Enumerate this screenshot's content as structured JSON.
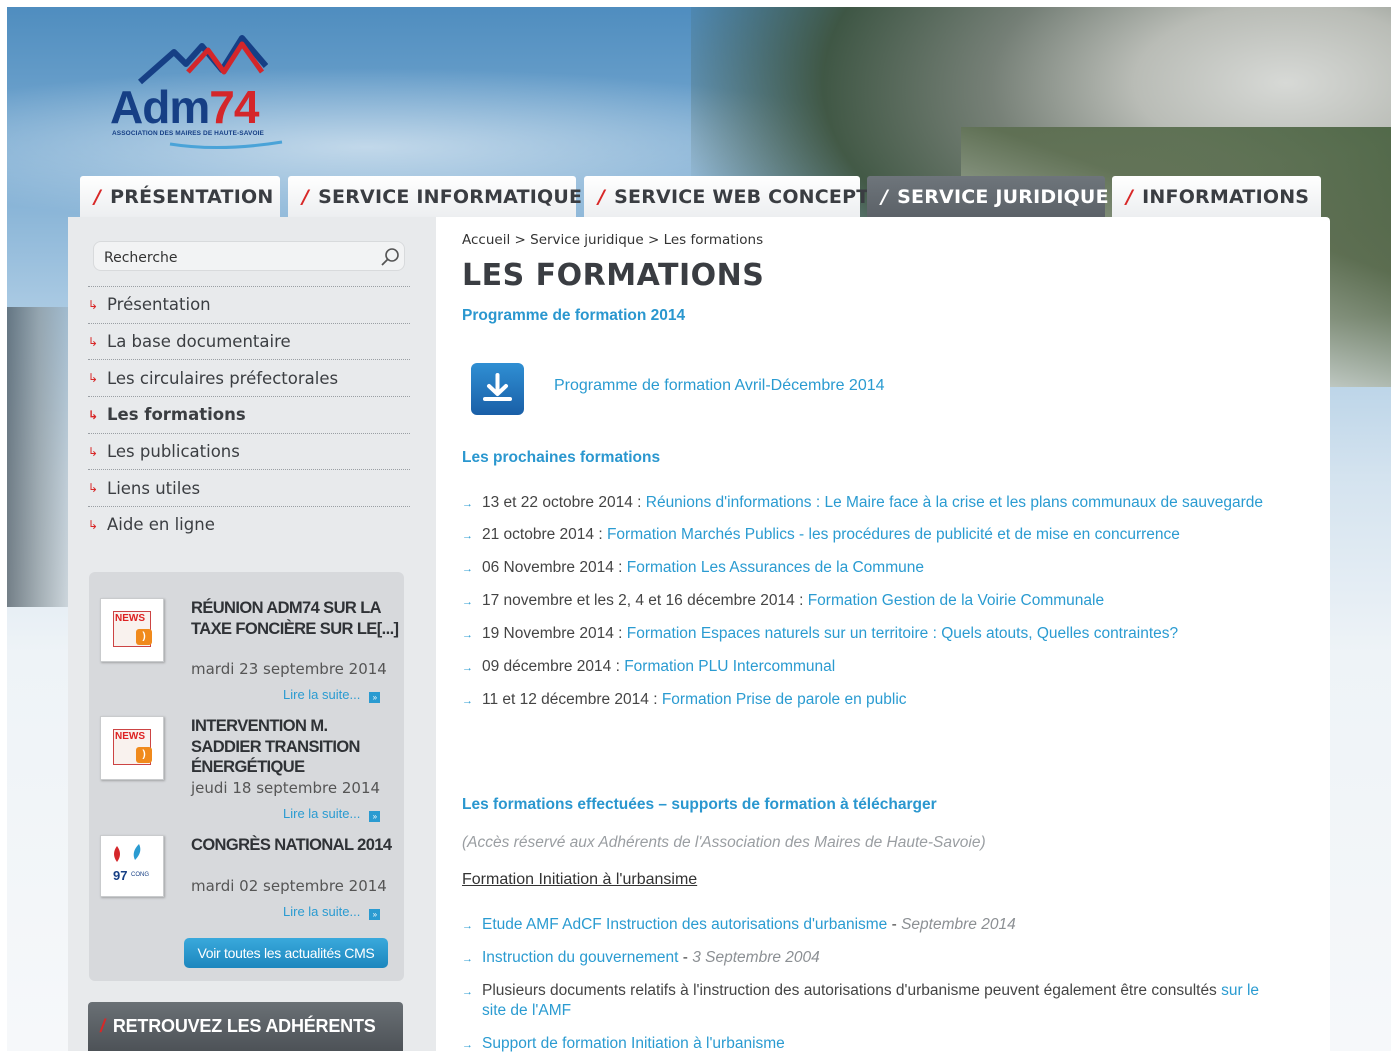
{
  "logo": {
    "name_prefix": "Adm",
    "name_suffix": "74",
    "subtitle": "ASSOCIATION DES MAIRES DE HAUTE-SAVOIE"
  },
  "nav": {
    "tabs": [
      {
        "label": "PRÉSENTATION",
        "active": false
      },
      {
        "label": "SERVICE INFORMATIQUE",
        "active": false
      },
      {
        "label": "SERVICE WEB CONCEPT",
        "active": false
      },
      {
        "label": "SERVICE JURIDIQUE",
        "active": true
      },
      {
        "label": "INFORMATIONS",
        "active": false
      }
    ]
  },
  "search": {
    "placeholder": "Recherche"
  },
  "sidebar": {
    "items": [
      {
        "label": "Présentation"
      },
      {
        "label": "La base documentaire"
      },
      {
        "label": "Les circulaires préfectorales"
      },
      {
        "label": "Les formations",
        "current": true
      },
      {
        "label": "Les publications"
      },
      {
        "label": "Liens utiles"
      },
      {
        "label": "Aide en ligne"
      }
    ]
  },
  "news": {
    "items": [
      {
        "title": "RÉUNION ADM74 SUR LA TAXE FONCIÈRE SUR LE[...]",
        "date": "mardi 23 septembre 2014",
        "more": "Lire la suite...",
        "thumb": "NEWS"
      },
      {
        "title": "INTERVENTION M. SADDIER TRANSITION ÉNERGÉTIQUE",
        "date": "jeudi 18 septembre 2014",
        "more": "Lire la suite...",
        "thumb": "NEWS"
      },
      {
        "title": "CONGRÈS NATIONAL 2014",
        "date": "mardi 02 septembre 2014",
        "more": "Lire la suite...",
        "thumb": "97e CONG"
      }
    ],
    "all_button": "Voir toutes les actualités CMS"
  },
  "adherents_banner": "RETROUVEZ LES ADHÉRENTS",
  "breadcrumb": {
    "home": "Accueil",
    "section": "Service juridique",
    "current": "Les formations"
  },
  "main": {
    "title": "LES FORMATIONS",
    "programme_heading": "Programme de formation 2014",
    "programme_link": "Programme de formation Avril-Décembre 2014",
    "upcoming_heading": "Les prochaines formations",
    "upcoming": [
      {
        "date": "13 et 22 octobre 2014 :",
        "link": "Réunions d'informations : Le Maire face à la crise et les plans communaux de sauvegarde"
      },
      {
        "date": "21 octobre 2014 :",
        "link": "Formation Marchés Publics - les procédures de publicité et de mise en concurrence"
      },
      {
        "date": "06 Novembre 2014 :",
        "link": "Formation Les Assurances de la Commune"
      },
      {
        "date": "17 novembre et les 2, 4 et 16 décembre 2014 :",
        "link": "Formation Gestion de la Voirie Communale"
      },
      {
        "date": "19 Novembre 2014 :",
        "link": "Formation Espaces naturels sur un territoire : Quels atouts, Quelles contraintes?"
      },
      {
        "date": "09 décembre 2014 :",
        "link": "Formation PLU Intercommunal"
      },
      {
        "date": "11 et 12 décembre 2014 :",
        "link": "Formation Prise de parole en public"
      }
    ],
    "done_heading": "Les formations effectuées – supports de formation à télécharger",
    "restricted_note": "(Accès réservé aux Adhérents de l'Association des Maires de Haute-Savoie)",
    "urbanisme_heading": "Formation Initiation à l'urbansime",
    "urbanisme_items": [
      {
        "link": "Etude AMF AdCF Instruction des autorisations d'urbanisme",
        "sep": " - ",
        "date": "Septembre 2014"
      },
      {
        "link": "Instruction du gouvernement",
        "sep": " - ",
        "date": "3 Septembre 2004"
      },
      {
        "text": "Plusieurs documents relatifs à l'instruction des autorisations d'urbanisme peuvent également être consultés",
        "link": "sur le site de l'AMF"
      },
      {
        "link": "Support de formation Initiation à l'urbanisme"
      }
    ]
  },
  "colors": {
    "accent": "#2a9bd1",
    "brand_red": "#d82828",
    "nav_active": "#5f666c",
    "title": "#3a3d42"
  }
}
